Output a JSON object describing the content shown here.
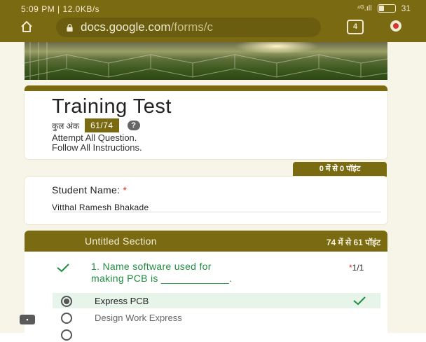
{
  "status_bar": {
    "time_data": "5:09 PM | 12.0KB/s",
    "signal": "⁴ᴳ.ıll",
    "battery": "31"
  },
  "browser": {
    "url_host": "docs.google.com",
    "url_path": "/forms/c",
    "tab_count": "4",
    "icons": [
      "home-icon",
      "lock-icon",
      "tabs-icon",
      "menu-icon"
    ]
  },
  "form": {
    "title": "Training Test",
    "total_label": "कुल अंक",
    "score": "61/74",
    "help": "?",
    "description_line1": "Attempt All Question.",
    "description_line2": "Follow All Instructions."
  },
  "name_question": {
    "points": "0 में से 0 पॉइंट",
    "label": "Student Name:",
    "required": "*",
    "answer": "Vitthal Ramesh Bhakade"
  },
  "section": {
    "title": "Untitled Section",
    "points": "74 में से 61 पॉइंट"
  },
  "question1": {
    "text_line1": "1. Name software used for",
    "text_line2": "making PCB is ____________.",
    "required": "*",
    "score": "1/1",
    "options": [
      {
        "label": "Express PCB",
        "selected": true,
        "correct": true
      },
      {
        "label": "Design Work Express",
        "selected": false,
        "correct": false
      }
    ]
  },
  "colors": {
    "accent": "#7a6a12",
    "correct": "#1e8e3e",
    "correct_bg": "#e6f4ea",
    "required": "#d93025"
  }
}
